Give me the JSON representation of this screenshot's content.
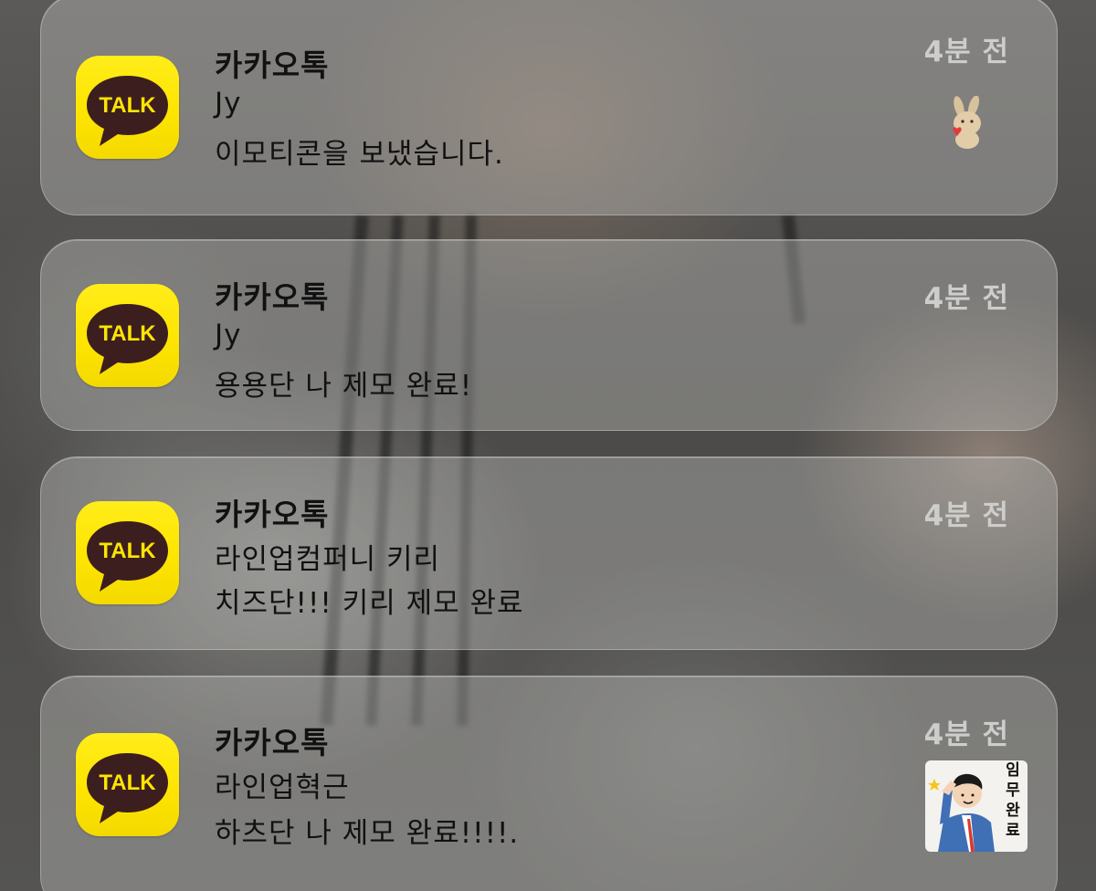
{
  "notifications": [
    {
      "app_name": "카카오톡",
      "time": "4분 전",
      "sender": "Jy",
      "message": "이모티콘을 보냈습니다.",
      "icon": "kakaotalk-icon",
      "icon_label": "TALK",
      "thumbnail": "bunny-emoticon"
    },
    {
      "app_name": "카카오톡",
      "time": "4분 전",
      "sender": "Jy",
      "message": "용용단 나 제모 완료!",
      "icon": "kakaotalk-icon",
      "icon_label": "TALK"
    },
    {
      "app_name": "카카오톡",
      "time": "4분 전",
      "sender": "라인업컴퍼니 키리",
      "message": "치즈단!!! 키리 제모 완료",
      "icon": "kakaotalk-icon",
      "icon_label": "TALK"
    },
    {
      "app_name": "카카오톡",
      "time": "4분 전",
      "sender": "라인업혁근",
      "message": "하츠단 나 제모 완료!!!!.",
      "icon": "kakaotalk-icon",
      "icon_label": "TALK",
      "thumbnail": "salute-man-emoticon",
      "thumbnail_text": "임무완료"
    }
  ],
  "colors": {
    "kakao_yellow": "#fee500",
    "kakao_brown": "#3c1e1e",
    "card_bg": "#b9b9b7"
  }
}
